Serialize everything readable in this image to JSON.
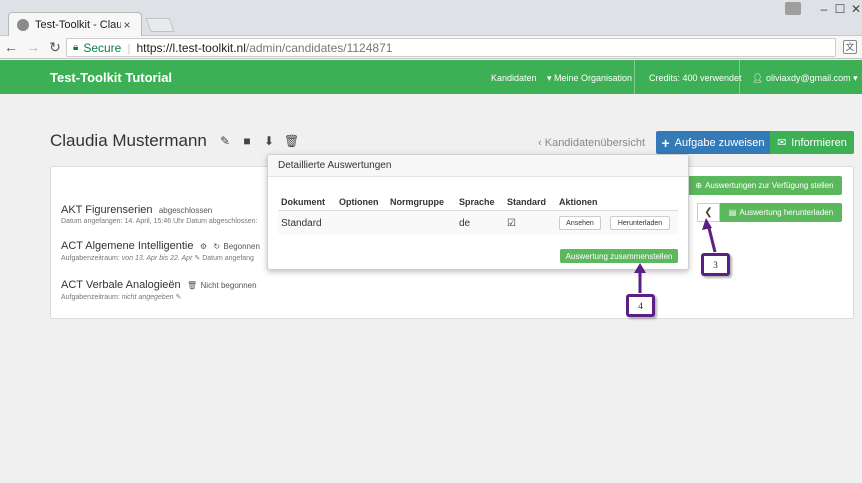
{
  "browser": {
    "tab_title": "Test-Toolkit - Claudia Mu",
    "tab_close": "×",
    "minimize": "–",
    "maximize": "☐",
    "close": "✕",
    "secure_label": "Secure",
    "url_host": "https://l.test-toolkit.nl",
    "url_path": "/admin/candidates/1124871"
  },
  "navbar": {
    "brand": "Test-Toolkit Tutorial",
    "candidates": "Kandidaten",
    "organization": "▾ Meine Organisation",
    "credits": "Credits: 400 verwendet",
    "user": "oliviaxdy@gmail.com ▾"
  },
  "page": {
    "title": "Claudia Mustermann",
    "back_link": "Kandidatenübersicht",
    "assign_button": "Aufgabe zuweisen",
    "inform_button": "Informieren",
    "make_available_button": "Auswertungen zur Verfügung stellen",
    "download_eval_button": "Auswertung herunterladen"
  },
  "tasks": [
    {
      "title": "AKT Figurenserien",
      "status": "abgeschlossen",
      "meta": "Datum angefangen: 14. April, 15:46 Uhr Datum abgeschlossen:"
    },
    {
      "title": "ACT Algemene Intelligentie",
      "status": "Begonnen",
      "meta_label": "Aufgabenzeitraum:",
      "meta_value": "von 13. Apr bis 22. Apr",
      "meta_tail": "Datum angefang"
    },
    {
      "title": "ACT Verbale Analogieën",
      "status": "Nicht begonnen",
      "meta_label": "Aufgabenzeitraum:",
      "meta_value": "nicht angegeben"
    }
  ],
  "popover": {
    "title": "Detaillierte Auswertungen",
    "columns": [
      "Dokument",
      "Optionen",
      "Normgruppe",
      "Sprache",
      "Standard",
      "Aktionen"
    ],
    "row": {
      "document": "Standard",
      "language": "de"
    },
    "view_button": "Ansehen",
    "download_button": "Herunterladen",
    "compile_button": "Auswertung zusammenstellen"
  },
  "callouts": {
    "step3": "3",
    "step4": "4"
  },
  "colors": {
    "navbar": "#3db056",
    "primary": "#337ab7",
    "success": "#5cb85c",
    "callout_border": "#5b1f86"
  }
}
